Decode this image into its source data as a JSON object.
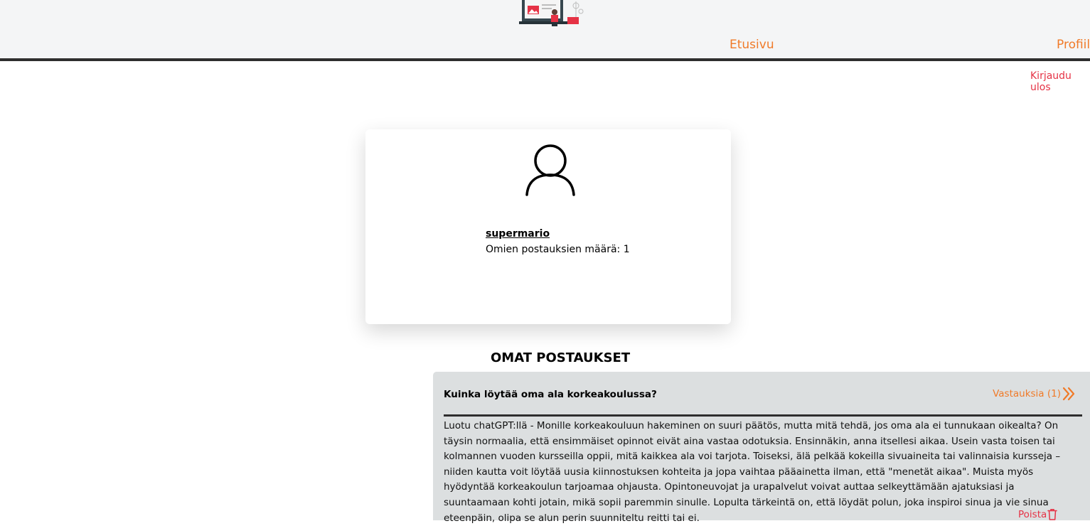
{
  "header": {
    "nav": {
      "home_label": "Etusivu",
      "profile_label": "Profiili"
    },
    "logout_label": "Kirjaudu ulos"
  },
  "profile": {
    "username": "supermario",
    "post_count_label": "Omien postauksien määrä: 1"
  },
  "posts_section": {
    "title": "OMAT POSTAUKSET",
    "posts": [
      {
        "title": "Kuinka löytää oma ala korkeakoulussa?",
        "replies_label": "Vastauksia (1)",
        "body": "Luotu chatGPT:llä - Monille korkeakouluun hakeminen on suuri päätös, mutta mitä tehdä, jos oma ala ei tunnukaan oikealta? On täysin normaalia, että ensimmäiset opinnot eivät aina vastaa odotuksia. Ensinnäkin, anna itsellesi aikaa. Usein vasta toisen tai kolmannen vuoden kursseilla oppii, mitä kaikkea ala voi tarjota. Toiseksi, älä pelkää kokeilla sivuaineita tai valinnaisia kursseja – niiden kautta voit löytää uusia kiinnostuksen kohteita ja jopa vaihtaa pääainetta ilman, että \"menetät aikaa\". Muista myös hyödyntää korkeakoulun tarjoamaa ohjausta. Opintoneuvojat ja urapalvelut voivat auttaa selkeyttämään ajatuksiasi ja suuntaamaan kohti jotain, mikä sopii paremmin sinulle. Lopulta tärkeintä on, että löydät polun, joka inspiroi sinua ja vie sinua eteenpäin, olipa se alun perin suunniteltu reitti tai ei.",
        "delete_label": "Poista"
      }
    ]
  },
  "colors": {
    "accent_orange": "#f07a28",
    "danger_red": "#e53245",
    "header_bg": "#f4f5f6",
    "post_bg": "#dcdfe0"
  },
  "icons": {
    "logo": "illustration-logo",
    "avatar": "user-outline-icon",
    "replies": "double-chevron-right-icon",
    "delete": "trash-icon"
  }
}
